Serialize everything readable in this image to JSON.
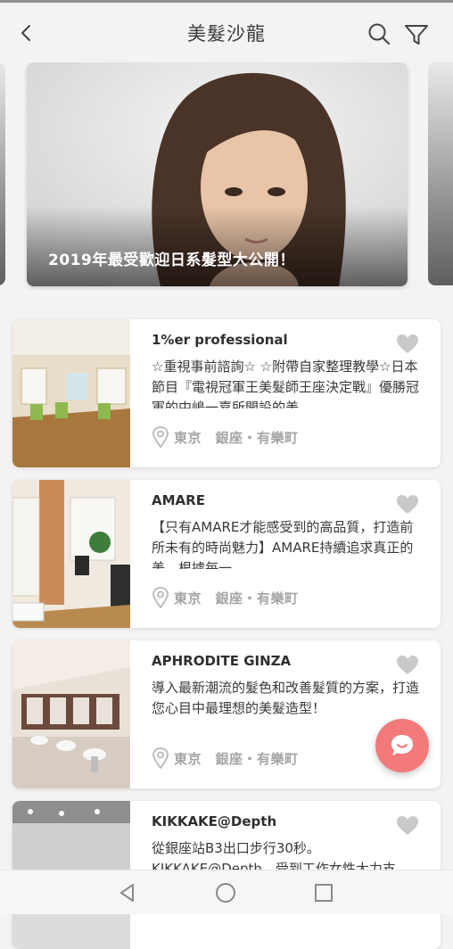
{
  "header": {
    "title": "美髮沙龍",
    "back_icon": "chevron-left-icon",
    "search_icon": "search-icon",
    "filter_icon": "filter-icon"
  },
  "banner": {
    "caption": "2019年最受歡迎日系髮型大公開！"
  },
  "salons": [
    {
      "name": "1%er professional",
      "description": "☆重視事前諮詢☆ ☆附帶自家整理教學☆日本節目『電視冠軍王美髮師王座決定戰』優勝冠軍的中嶋一嘉所開設的美",
      "location": "東京　銀座・有樂町"
    },
    {
      "name": "AMARE",
      "description": "【只有AMARE才能感受到的高品質，打造前所未有的時尚魅力】AMARE持續追求真正的美。根據每一",
      "location": "東京　銀座・有樂町"
    },
    {
      "name": "APHRODITE GINZA",
      "description": "導入最新潮流的髮色和改善髮質的方案，打造您心目中最理想的美髮造型！",
      "location": "東京　銀座・有樂町"
    },
    {
      "name": "KIKKAKE@Depth",
      "description": "從銀座站B3出口步行30秒。KIKKAKE@Depth，受到工作女性大力支",
      "location": ""
    }
  ],
  "colors": {
    "accent": "#f27a7a",
    "background": "#f4f3f3",
    "muted": "#a5a5a5"
  }
}
